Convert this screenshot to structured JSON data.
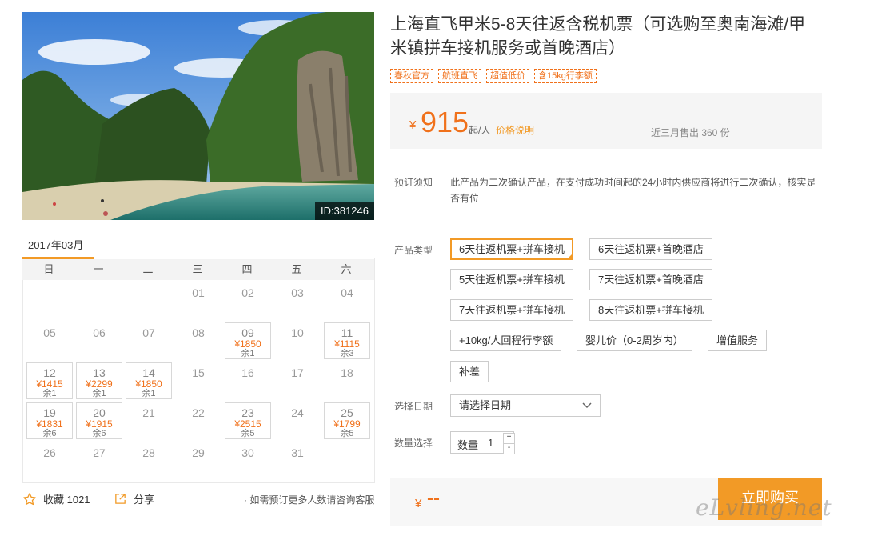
{
  "photo": {
    "id_label": "ID:381246"
  },
  "calendar": {
    "month": "2017年03月",
    "weekdays": [
      "日",
      "一",
      "二",
      "三",
      "四",
      "五",
      "六"
    ],
    "weeks": [
      [
        null,
        null,
        null,
        {
          "day": "01"
        },
        {
          "day": "02"
        },
        {
          "day": "03"
        },
        {
          "day": "04"
        }
      ],
      [
        {
          "day": "05"
        },
        {
          "day": "06"
        },
        {
          "day": "07"
        },
        {
          "day": "08"
        },
        {
          "day": "09",
          "price": "¥1850",
          "remain": "余1"
        },
        {
          "day": "10"
        },
        {
          "day": "11",
          "price": "¥1115",
          "remain": "余3"
        }
      ],
      [
        {
          "day": "12",
          "price": "¥1415",
          "remain": "余1"
        },
        {
          "day": "13",
          "price": "¥2299",
          "remain": "余1"
        },
        {
          "day": "14",
          "price": "¥1850",
          "remain": "余1"
        },
        {
          "day": "15"
        },
        {
          "day": "16"
        },
        {
          "day": "17"
        },
        {
          "day": "18"
        }
      ],
      [
        {
          "day": "19",
          "price": "¥1831",
          "remain": "余6"
        },
        {
          "day": "20",
          "price": "¥1915",
          "remain": "余6"
        },
        {
          "day": "21"
        },
        {
          "day": "22"
        },
        {
          "day": "23",
          "price": "¥2515",
          "remain": "余5"
        },
        {
          "day": "24"
        },
        {
          "day": "25",
          "price": "¥1799",
          "remain": "余5"
        }
      ],
      [
        {
          "day": "26"
        },
        {
          "day": "27"
        },
        {
          "day": "28"
        },
        {
          "day": "29"
        },
        {
          "day": "30"
        },
        {
          "day": "31"
        },
        null
      ]
    ]
  },
  "actions": {
    "favorite_label": "收藏 1021",
    "share_label": "分享",
    "consult_text": "· 如需预订更多人数请咨询客服"
  },
  "product": {
    "title": "上海直飞甲米5-8天往返含税机票（可选购至奥南海滩/甲米镇拼车接机服务或首晚酒店）",
    "tags": [
      "春秋官方",
      "航班直飞",
      "超值低价",
      "含15kg行李额"
    ],
    "price_symbol": "¥",
    "price": "915",
    "price_unit": "起/人",
    "price_explain": "价格说明",
    "sold_text": "近三月售出 360 份",
    "notice_label": "预订须知",
    "notice_text": "此产品为二次确认产品，在支付成功时间起的24小时内供应商将进行二次确认，核实是否有位",
    "type_label": "产品类型",
    "types": [
      {
        "label": "6天往返机票+拼车接机",
        "selected": true
      },
      {
        "label": "6天往返机票+首晚酒店",
        "selected": false
      },
      {
        "label": "5天往返机票+拼车接机",
        "selected": false
      },
      {
        "label": "7天往返机票+首晚酒店",
        "selected": false
      },
      {
        "label": "7天往返机票+拼车接机",
        "selected": false
      },
      {
        "label": "8天往返机票+拼车接机",
        "selected": false
      },
      {
        "label": "+10kg/人回程行李额",
        "selected": false
      },
      {
        "label": "婴儿价（0-2周岁内）",
        "selected": false
      },
      {
        "label": "增值服务",
        "selected": false
      },
      {
        "label": "补差",
        "selected": false
      }
    ],
    "date_label": "选择日期",
    "date_placeholder": "请选择日期",
    "qty_label": "数量选择",
    "qty_field_label": "数量",
    "qty_value": "1",
    "total_symbol": "¥",
    "total_value": "--",
    "buy_label": "立即购买"
  },
  "watermark": "eLvling.net",
  "colors": {
    "accent": "#f29a26",
    "price": "#f0711b"
  }
}
